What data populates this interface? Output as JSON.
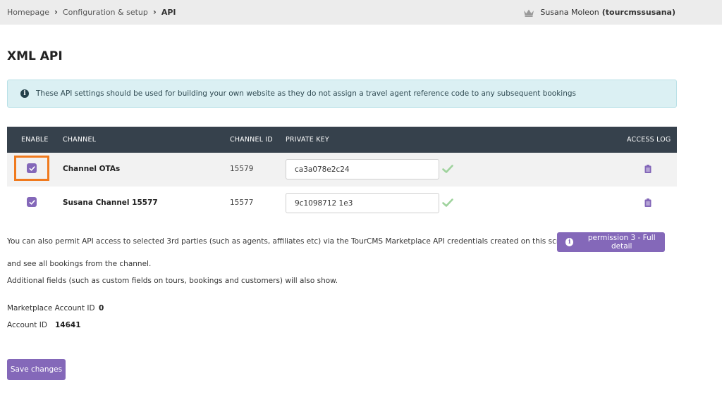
{
  "breadcrumb": {
    "items": [
      "Homepage",
      "Configuration & setup"
    ],
    "current": "API"
  },
  "user": {
    "name": "Susana Moleon",
    "login": "(tourcmssusana)"
  },
  "page_title": "XML API",
  "info": {
    "text": "These API settings should be used for building your own website as they do not assign a travel agent reference code to any subsequent bookings"
  },
  "table": {
    "headers": {
      "enable": "ENABLE",
      "channel": "CHANNEL",
      "channel_id": "CHANNEL ID",
      "private_key": "PRIVATE KEY",
      "access_log": "ACCESS LOG"
    },
    "rows": [
      {
        "enabled": true,
        "channel": "Channel OTAs",
        "channel_id": "15579",
        "private_key": "ca3a078e2c24"
      },
      {
        "enabled": true,
        "channel": "Susana Channel 15577",
        "channel_id": "15577",
        "private_key": "9c1098712 1e3"
      }
    ]
  },
  "marketplace": {
    "line1": "You can also permit API access to selected 3rd parties (such as agents, affiliates etc) via the TourCMS Marketplace API credentials created on this screen will be",
    "permission_button": "permission 3 - Full detail",
    "line2": "and see all bookings from the channel.",
    "line3": "Additional fields (such as custom fields on tours, bookings and customers) will also show."
  },
  "account": {
    "marketplace_label": "Marketplace Account ID",
    "marketplace_value": "0",
    "account_label": "Account ID",
    "account_value": "14641"
  },
  "save_label": "Save changes",
  "colors": {
    "accent": "#8468b9",
    "header_bg": "#36414c",
    "highlight": "#f07a1e",
    "info_bg": "#dbf0f3",
    "check": "#9fd39d"
  }
}
